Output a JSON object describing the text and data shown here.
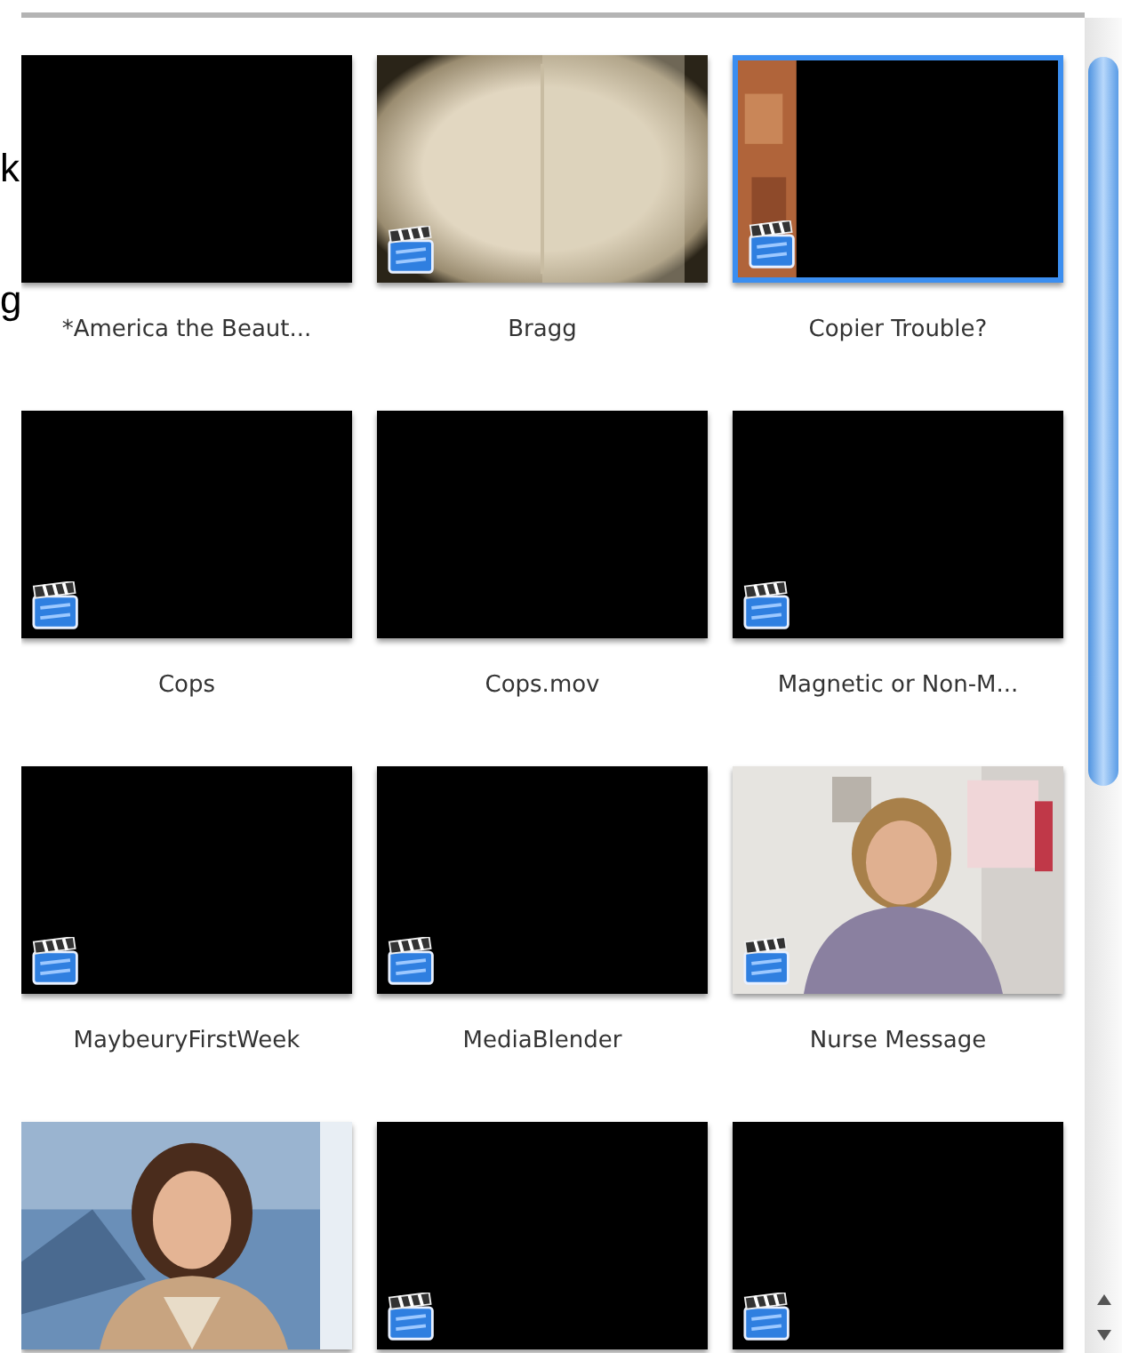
{
  "background_letters": [
    "k",
    "g"
  ],
  "items": [
    {
      "label": "*America the Beaut...",
      "kind": "black",
      "movie_badge": false,
      "selected": false
    },
    {
      "label": "Bragg",
      "kind": "paper",
      "movie_badge": true,
      "selected": false
    },
    {
      "label": "Copier Trouble?",
      "kind": "strip",
      "movie_badge": true,
      "selected": true
    },
    {
      "label": "Cops",
      "kind": "black",
      "movie_badge": true,
      "selected": false
    },
    {
      "label": "Cops.mov",
      "kind": "black",
      "movie_badge": false,
      "selected": false
    },
    {
      "label": "Magnetic or Non-M...",
      "kind": "black",
      "movie_badge": true,
      "selected": false
    },
    {
      "label": "MaybeuryFirstWeek",
      "kind": "black",
      "movie_badge": true,
      "selected": false
    },
    {
      "label": "MediaBlender",
      "kind": "black",
      "movie_badge": true,
      "selected": false
    },
    {
      "label": "Nurse Message",
      "kind": "office",
      "movie_badge": true,
      "selected": false
    },
    {
      "kind": "poster",
      "movie_badge": false,
      "selected": false
    },
    {
      "kind": "black",
      "movie_badge": true,
      "selected": false
    },
    {
      "kind": "black",
      "movie_badge": true,
      "selected": false
    }
  ]
}
